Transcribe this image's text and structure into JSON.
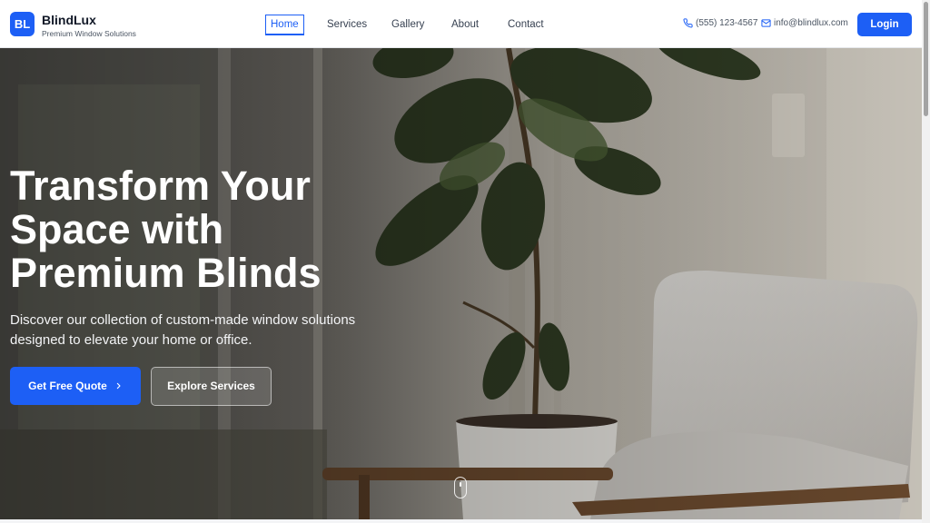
{
  "brand": {
    "badge": "BL",
    "name": "BlindLux",
    "tagline": "Premium Window Solutions"
  },
  "nav": {
    "items": [
      {
        "label": "Home",
        "active": true
      },
      {
        "label": "Services",
        "active": false
      },
      {
        "label": "Gallery",
        "active": false
      },
      {
        "label": "About",
        "active": false
      },
      {
        "label": "Contact",
        "active": false
      }
    ]
  },
  "contact": {
    "phone": "(555) 123-4567",
    "phone_icon": "phone-icon",
    "email": "info@blindlux.com",
    "email_icon": "mail-icon"
  },
  "header": {
    "login_label": "Login"
  },
  "hero": {
    "title": "Transform Your Space with Premium Blinds",
    "subtitle": "Discover our collection of custom-made window solutions designed to elevate your home or office.",
    "primary_cta": "Get Free Quote",
    "primary_cta_icon": "chevron-right-icon",
    "secondary_cta": "Explore Services",
    "background_image": "room with fiddle-leaf fig plant and white armchair",
    "scroll_icon": "mouse-scroll-icon"
  },
  "colors": {
    "accent": "#1d5ff5",
    "text_dark": "#111827",
    "text_muted": "#4b5563"
  }
}
